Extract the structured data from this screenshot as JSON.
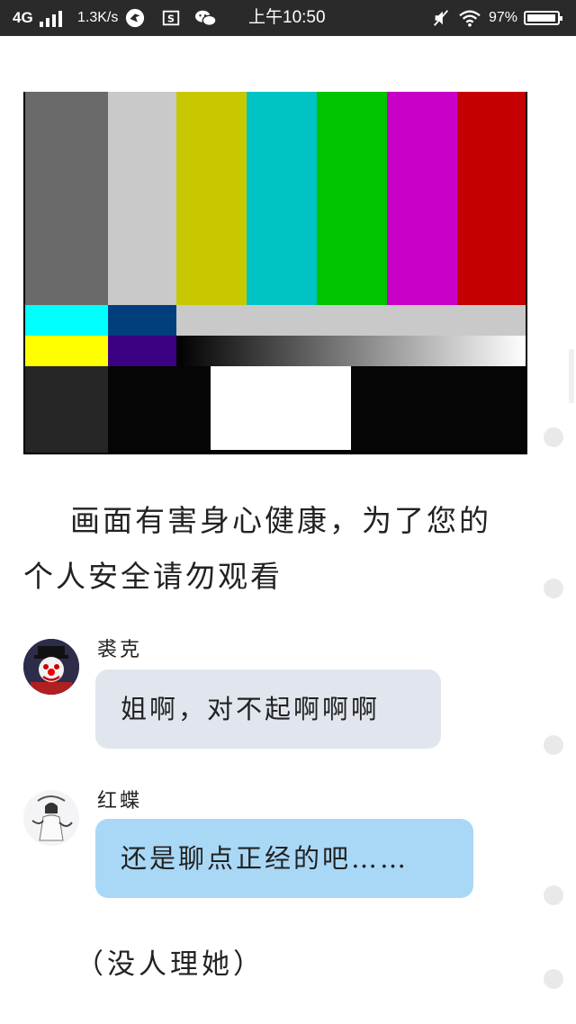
{
  "status_bar": {
    "network": "4G",
    "speed": "1.3K/s",
    "time": "上午10:50",
    "battery": "97%"
  },
  "article": {
    "image_alt": "color bar test pattern",
    "para_line1": "画面有害身心健康，为了您的",
    "para_line2": "个人安全请勿观看"
  },
  "messages": [
    {
      "name": "裘克",
      "text": "姐啊，对不起啊啊啊",
      "bubble_color": "#e1e6ee"
    },
    {
      "name": "红蝶",
      "text": "还是聊点正经的吧……",
      "bubble_color": "#a9d8f6"
    }
  ],
  "aside_text": "（没人理她）",
  "colors": {
    "status_bar_bg": "#2a2a2a",
    "bubble_grey": "#e1e6ee",
    "bubble_blue": "#a9d8f6"
  }
}
